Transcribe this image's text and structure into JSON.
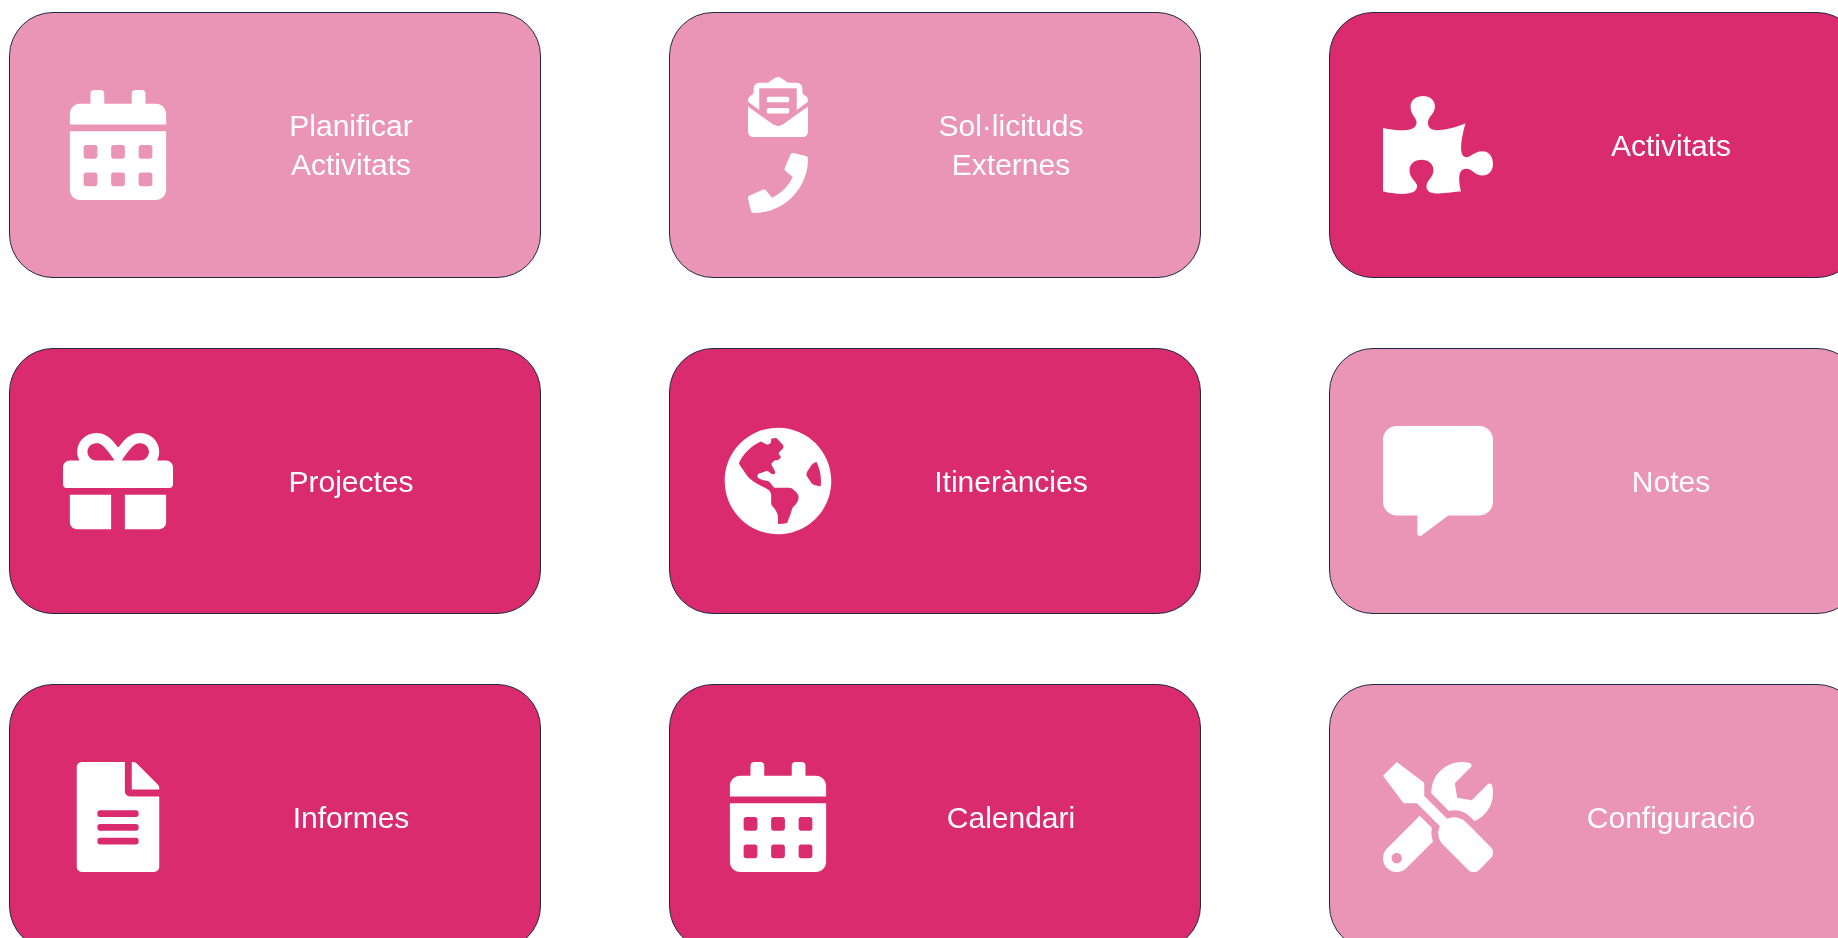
{
  "tiles": [
    {
      "label": "Planificar\nActivitats",
      "color": "#eb95b6"
    },
    {
      "label": "Sol·licituds\nExternes",
      "color": "#eb95b6"
    },
    {
      "label": "Activitats",
      "color": "#da2b6f"
    },
    {
      "label": "Projectes",
      "color": "#da2b6f"
    },
    {
      "label": "Itineràncies",
      "color": "#da2b6f"
    },
    {
      "label": "Notes",
      "color": "#eb95b6"
    },
    {
      "label": "Informes",
      "color": "#da2b6f"
    },
    {
      "label": "Calendari",
      "color": "#da2b6f"
    },
    {
      "label": "Configuració",
      "color": "#eb95b6"
    }
  ]
}
